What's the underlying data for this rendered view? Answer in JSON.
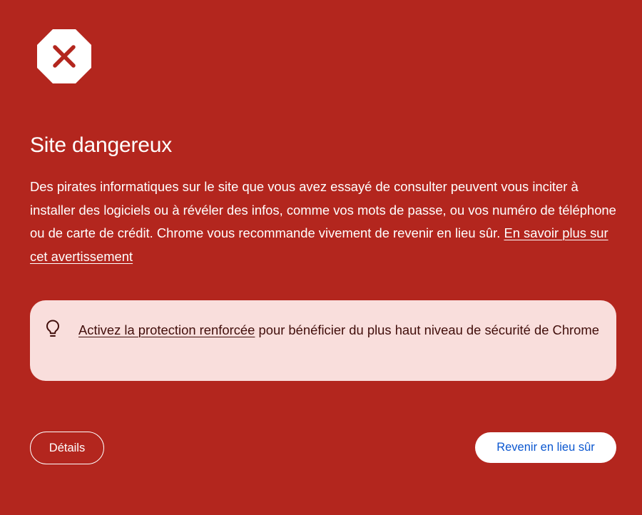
{
  "warning": {
    "icon": "danger-octagon-x-icon",
    "title": "Site dangereux",
    "description": "Des pirates informatiques sur le site que vous avez essayé de consulter peuvent vous inciter à installer des logiciels ou à révéler des infos, comme vos mots de passe, ou vos numéro de téléphone ou de carte de crédit. Chrome vous recommande vivement de revenir en lieu sûr.",
    "learn_more_link": "En savoir plus sur cet avertissement"
  },
  "tip": {
    "icon": "lightbulb-icon",
    "link": "Activez la protection renforcée",
    "text": "pour bénéficier du plus haut niveau de sécurité de Chrome"
  },
  "buttons": {
    "details": "Détails",
    "back_to_safety": "Revenir en lieu sûr"
  },
  "colors": {
    "background": "#b3261e",
    "tip_background": "#f9dedc",
    "tip_text": "#410e0b",
    "primary_button_text": "#0b57d0",
    "foreground": "#ffffff"
  }
}
